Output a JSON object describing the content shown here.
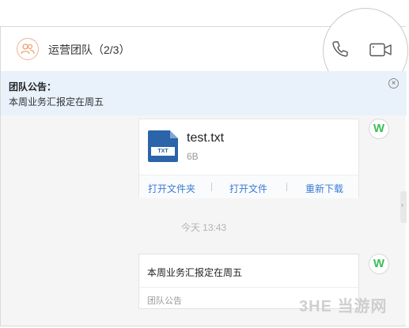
{
  "header": {
    "title": "运营团队（2/3）",
    "group_icon": "group-users-icon",
    "call_icon": "phone-icon",
    "video_icon": "video-camera-icon"
  },
  "announcement": {
    "title": "团队公告：",
    "text": "本周业务汇报定在周五",
    "close_icon": "close-circle-icon"
  },
  "messages": {
    "file": {
      "avatar_letter": "W",
      "icon_label": "TXT",
      "name": "test.txt",
      "size": "6B",
      "actions": [
        "打开文件夹",
        "打开文件",
        "重新下载"
      ]
    },
    "timestamp": "今天 13:43",
    "notice": {
      "avatar_letter": "W",
      "text": "本周业务汇报定在周五",
      "label": "团队公告"
    }
  },
  "watermark": "3HE 当游网",
  "colors": {
    "accent_blue": "#3a7bd5",
    "announce_bg": "#e9f2fb",
    "avatar_green": "#3bbf5a",
    "group_icon_orange": "#f0b48c"
  }
}
